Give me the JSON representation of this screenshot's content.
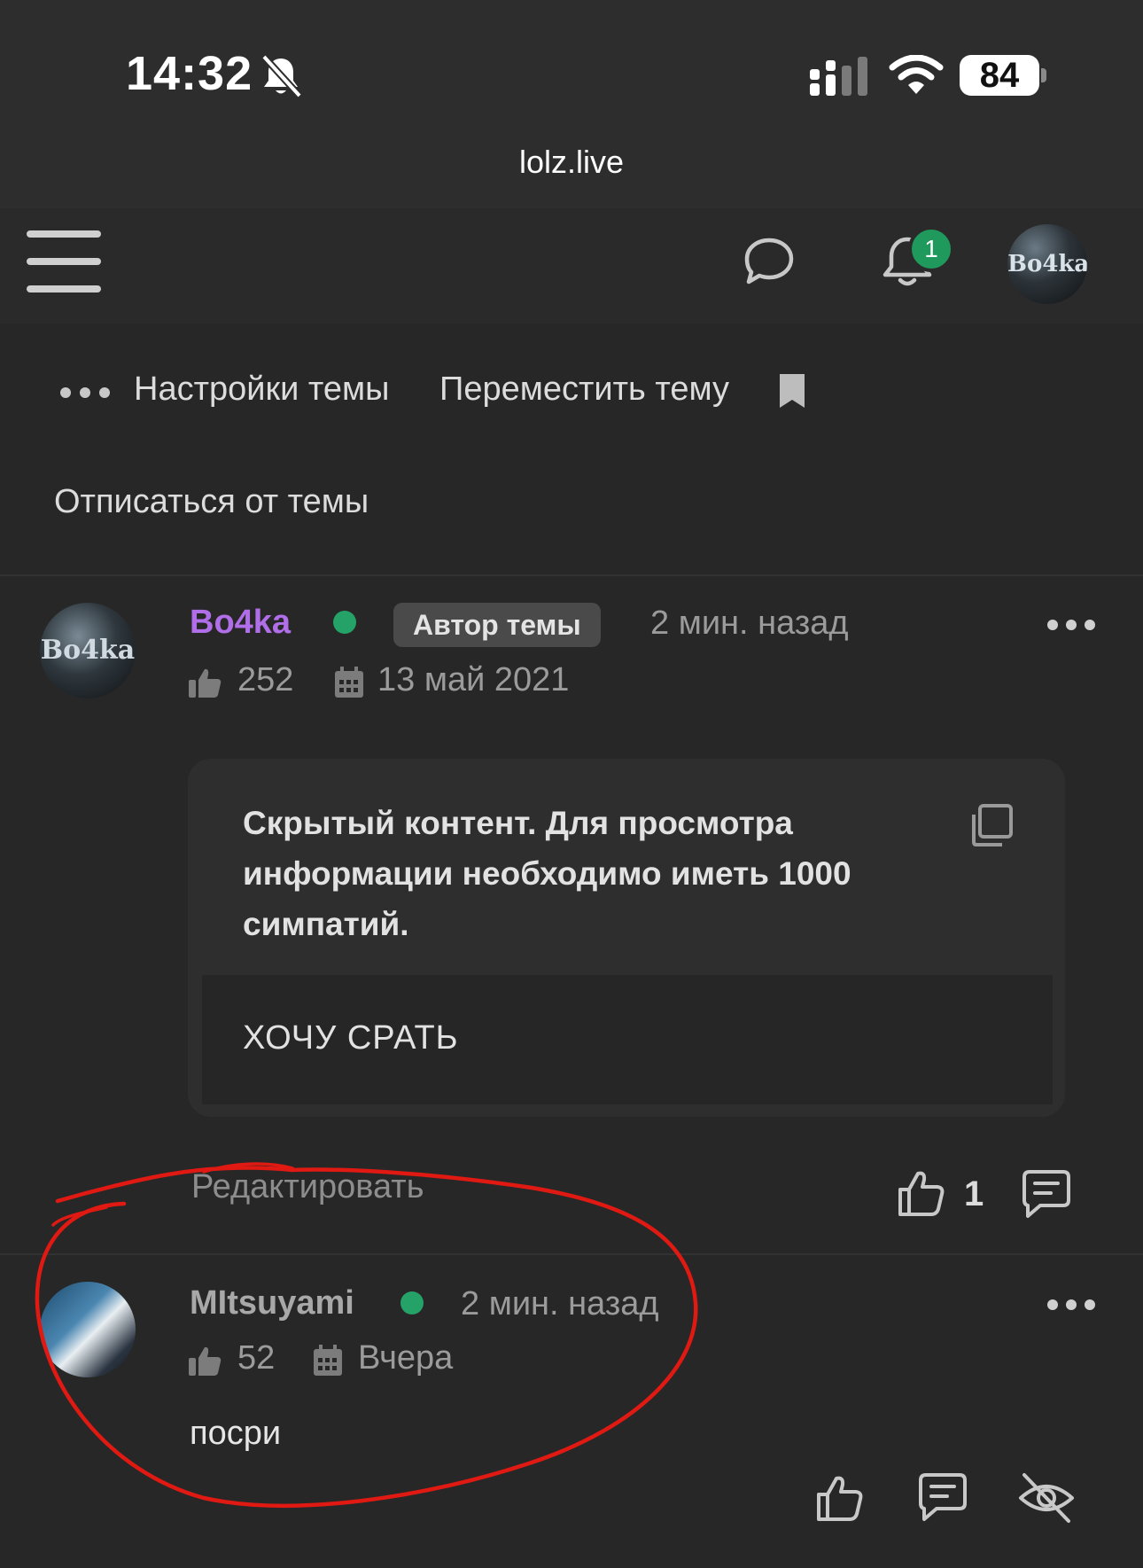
{
  "status_bar": {
    "time": "14:32",
    "battery": "84"
  },
  "browser": {
    "url": "lolz.live"
  },
  "header": {
    "notifications_count": "1",
    "avatar_text": "Bo4ka"
  },
  "thread_actions": {
    "settings": "Настройки темы",
    "move": "Переместить тему",
    "unsubscribe": "Отписаться от темы"
  },
  "posts": [
    {
      "username": "Bo4ka",
      "username_color": "#b06ee8",
      "badge": "Автор темы",
      "time": "2 мин. назад",
      "likes": "252",
      "registered": "13 май 2021",
      "avatar_text": "Bo4ka",
      "hidden_title": "Скрытый контент. Для просмотра информации необходимо иметь 1000 симпатий.",
      "hidden_content": "ХОЧУ СРАТЬ",
      "edit": "Редактировать",
      "reaction_count": "1"
    },
    {
      "username": "MItsuyami",
      "username_color": "#a8a8a8",
      "time": "2 мин. назад",
      "likes": "52",
      "registered": "Вчера",
      "text": "посри"
    }
  ],
  "colors": {
    "online": "#24a268",
    "annotation": "#e01a12"
  }
}
